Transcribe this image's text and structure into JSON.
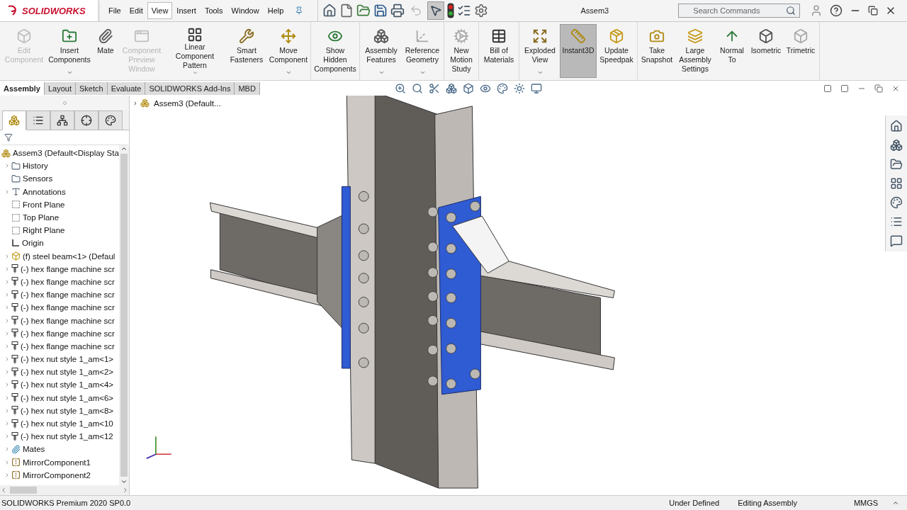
{
  "app_logo": "SOLIDWORKS",
  "menu": [
    {
      "label": "File",
      "selected": false
    },
    {
      "label": "Edit",
      "selected": false
    },
    {
      "label": "View",
      "selected": true
    },
    {
      "label": "Insert",
      "selected": false
    },
    {
      "label": "Tools",
      "selected": false
    },
    {
      "label": "Window",
      "selected": false
    },
    {
      "label": "Help",
      "selected": false
    }
  ],
  "select_tool": {
    "selected": true
  },
  "undo_tool": {
    "disabled": true
  },
  "window_title": "Assem3",
  "search": {
    "placeholder": "Search Commands"
  },
  "ribbon_groups": [
    [
      {
        "label": "Edit Component",
        "disabled": true,
        "selected": false,
        "dropdown": false
      },
      {
        "label": "Insert Components",
        "disabled": false,
        "selected": false,
        "dropdown": true
      },
      {
        "label": "Mate",
        "disabled": false,
        "selected": false,
        "dropdown": false
      },
      {
        "label": "Component Preview Window",
        "disabled": true,
        "selected": false,
        "dropdown": false
      },
      {
        "label": "Linear Component Pattern",
        "disabled": false,
        "selected": false,
        "dropdown": true
      },
      {
        "label": "Smart Fasteners",
        "disabled": false,
        "selected": false,
        "dropdown": false
      },
      {
        "label": "Move Component",
        "disabled": false,
        "selected": false,
        "dropdown": true
      }
    ],
    [
      {
        "label": "Show Hidden Components",
        "disabled": false,
        "selected": false,
        "dropdown": false
      }
    ],
    [
      {
        "label": "Assembly Features",
        "disabled": false,
        "selected": false,
        "dropdown": true
      },
      {
        "label": "Reference Geometry",
        "disabled": false,
        "selected": false,
        "dropdown": true
      }
    ],
    [
      {
        "label": "New Motion Study",
        "disabled": false,
        "selected": false,
        "dropdown": false
      }
    ],
    [
      {
        "label": "Bill of Materials",
        "disabled": false,
        "selected": false,
        "dropdown": false
      }
    ],
    [
      {
        "label": "Exploded View",
        "disabled": false,
        "selected": false,
        "dropdown": true
      },
      {
        "label": "Instant3D",
        "disabled": false,
        "selected": true,
        "dropdown": false
      },
      {
        "label": "Update Speedpak",
        "disabled": false,
        "selected": false,
        "dropdown": false
      }
    ],
    [
      {
        "label": "Take Snapshot",
        "disabled": false,
        "selected": false,
        "dropdown": false
      },
      {
        "label": "Large Assembly Settings",
        "disabled": false,
        "selected": false,
        "dropdown": false
      },
      {
        "label": "Normal To",
        "disabled": false,
        "selected": false,
        "dropdown": false
      },
      {
        "label": "Isometric",
        "disabled": false,
        "selected": false,
        "dropdown": false
      },
      {
        "label": "Trimetric",
        "disabled": false,
        "selected": false,
        "dropdown": false
      }
    ]
  ],
  "command_tabs": [
    {
      "label": "Assembly",
      "selected": true
    },
    {
      "label": "Layout",
      "selected": false
    },
    {
      "label": "Sketch",
      "selected": false
    },
    {
      "label": "Evaluate",
      "selected": false
    },
    {
      "label": "SOLIDWORKS Add-Ins",
      "selected": false
    },
    {
      "label": "MBD",
      "selected": false
    }
  ],
  "panel_tabs": [
    {
      "selected": true
    },
    {
      "selected": false
    },
    {
      "selected": false
    },
    {
      "selected": false
    },
    {
      "selected": false
    }
  ],
  "tree": {
    "label": "Assem3  (Default<Display Sta",
    "kind": "assembly",
    "children": [
      {
        "label": "History",
        "kind": "folder",
        "expandable": true
      },
      {
        "label": "Sensors",
        "kind": "folder",
        "expandable": false
      },
      {
        "label": "Annotations",
        "kind": "annotation",
        "expandable": true
      },
      {
        "label": "Front Plane",
        "kind": "plane",
        "expandable": false
      },
      {
        "label": "Top Plane",
        "kind": "plane",
        "expandable": false
      },
      {
        "label": "Right Plane",
        "kind": "plane",
        "expandable": false
      },
      {
        "label": "Origin",
        "kind": "origin",
        "expandable": false
      },
      {
        "label": "(f) steel beam<1> (Defaul",
        "kind": "part",
        "expandable": true
      },
      {
        "label": "(-) hex flange machine scr",
        "kind": "screw",
        "expandable": true
      },
      {
        "label": "(-) hex flange machine scr",
        "kind": "screw",
        "expandable": true
      },
      {
        "label": "(-) hex flange machine scr",
        "kind": "screw",
        "expandable": true
      },
      {
        "label": "(-) hex flange machine scr",
        "kind": "screw",
        "expandable": true
      },
      {
        "label": "(-) hex flange machine scr",
        "kind": "screw",
        "expandable": true
      },
      {
        "label": "(-) hex flange machine scr",
        "kind": "screw",
        "expandable": true
      },
      {
        "label": "(-) hex flange machine scr",
        "kind": "screw",
        "expandable": true
      },
      {
        "label": "(-) hex nut style 1_am<1>",
        "kind": "screw",
        "expandable": true
      },
      {
        "label": "(-) hex nut style 1_am<2>",
        "kind": "screw",
        "expandable": true
      },
      {
        "label": "(-) hex nut style 1_am<4>",
        "kind": "screw",
        "expandable": true
      },
      {
        "label": "(-) hex nut style 1_am<6>",
        "kind": "screw",
        "expandable": true
      },
      {
        "label": "(-) hex nut style 1_am<8>",
        "kind": "screw",
        "expandable": true
      },
      {
        "label": "(-) hex nut style 1_am<10",
        "kind": "screw",
        "expandable": true
      },
      {
        "label": "(-) hex nut style 1_am<12",
        "kind": "screw",
        "expandable": true
      },
      {
        "label": "Mates",
        "kind": "mates",
        "expandable": true
      },
      {
        "label": "MirrorComponent1",
        "kind": "mirror",
        "expandable": true
      },
      {
        "label": "MirrorComponent2",
        "kind": "mirror",
        "expandable": true
      }
    ]
  },
  "viewport_tree": {
    "label": "Assem3  (Default...",
    "expandable": true
  },
  "status_bar": {
    "product": "SOLIDWORKS Premium 2020 SP0.0",
    "state": "Under Defined",
    "mode": "Editing Assembly",
    "units": "MMGS"
  }
}
